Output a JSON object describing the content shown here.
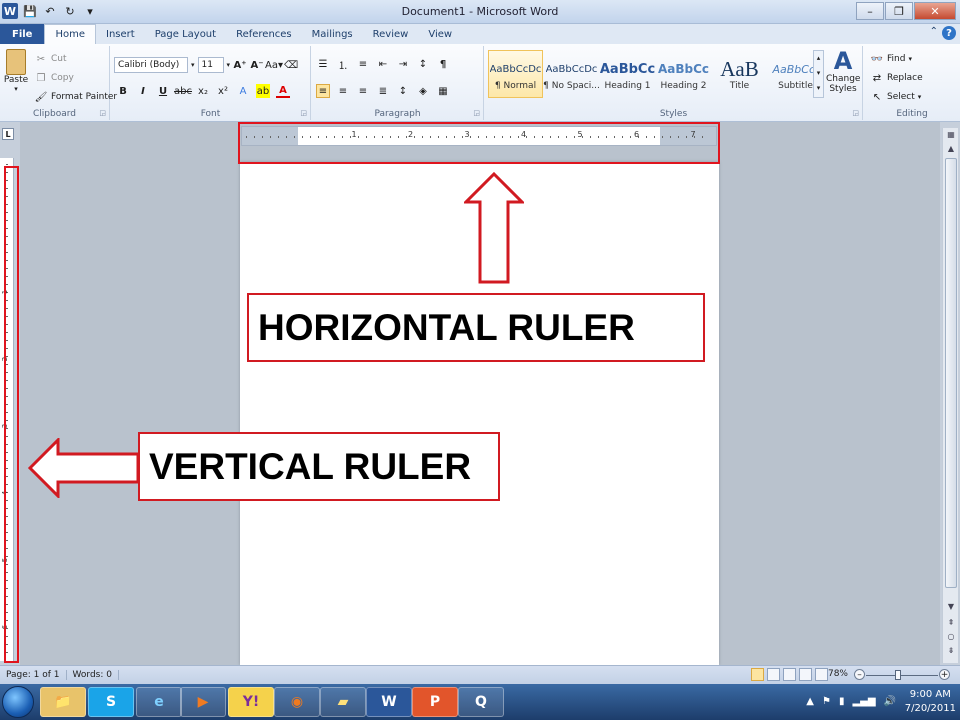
{
  "window": {
    "title": "Document1 - Microsoft Word"
  },
  "tabs": [
    "File",
    "Home",
    "Insert",
    "Page Layout",
    "References",
    "Mailings",
    "Review",
    "View"
  ],
  "clipboard": {
    "paste": "Paste",
    "cut": "Cut",
    "copy": "Copy",
    "format_painter": "Format Painter",
    "label": "Clipboard"
  },
  "font": {
    "name": "Calibri (Body)",
    "size": "11",
    "label": "Font"
  },
  "paragraph": {
    "label": "Paragraph"
  },
  "styles": {
    "label": "Styles",
    "items": [
      {
        "preview": "AaBbCcDc",
        "name": "¶ Normal"
      },
      {
        "preview": "AaBbCcDc",
        "name": "¶ No Spaci..."
      },
      {
        "preview": "AaBbCc",
        "name": "Heading 1"
      },
      {
        "preview": "AaBbCc",
        "name": "Heading 2"
      },
      {
        "preview": "AaB",
        "name": "Title"
      },
      {
        "preview": "AaBbCc.",
        "name": "Subtitle"
      }
    ],
    "change_styles": [
      "Change",
      "Styles"
    ]
  },
  "editing": {
    "find": "Find",
    "replace": "Replace",
    "select": "Select",
    "label": "Editing"
  },
  "ruler": {
    "h_labels": [
      "1",
      "2",
      "3",
      "4",
      "5",
      "6",
      "7"
    ],
    "v_labels": [
      "1",
      "2",
      "3",
      "4",
      "5",
      "6"
    ],
    "tab_selector": "L"
  },
  "annotations": {
    "horizontal": "HORIZONTAL RULER",
    "vertical": "VERTICAL RULER"
  },
  "status": {
    "page": "Page: 1 of 1",
    "words": "Words: 0",
    "zoom": "78%",
    "zoom_fraction": 0.78
  },
  "tray": {
    "time": "9:00 AM",
    "date": "7/20/2011"
  },
  "colors": {
    "annotation_red": "#e0141e",
    "file_tab": "#2b579a"
  }
}
